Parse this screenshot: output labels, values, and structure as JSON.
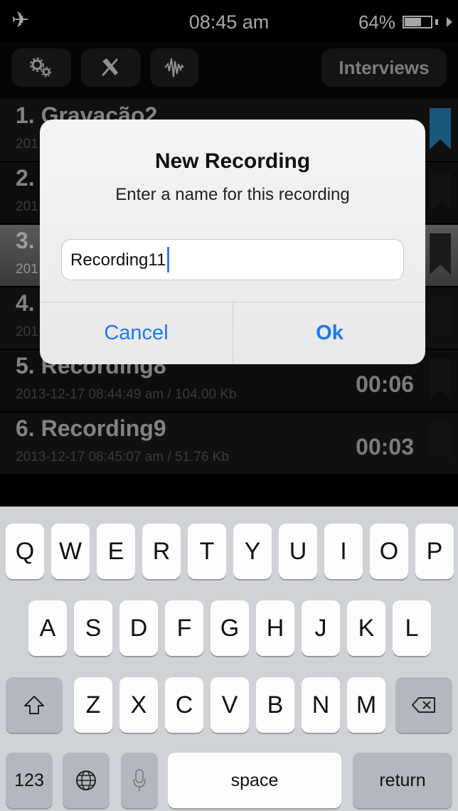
{
  "status_bar": {
    "airplane_icon": "airplane-icon",
    "time": "08:45 am",
    "battery_percent": "64%",
    "battery_level": 0.64
  },
  "toolbar": {
    "settings_icon": "gears-icon",
    "tools_icon": "tools-icon",
    "waveform_icon": "waveform-icon",
    "interviews_label": "Interviews"
  },
  "recordings": [
    {
      "title": "1. Gravação2",
      "meta": "201",
      "duration": "",
      "bookmarked": true
    },
    {
      "title": "2.",
      "meta": "201",
      "duration": "",
      "bookmarked": false
    },
    {
      "title": "3.",
      "meta": "201",
      "duration": "",
      "bookmarked": false,
      "selected": true
    },
    {
      "title": "4.",
      "meta": "201",
      "duration": "",
      "bookmarked": false
    },
    {
      "title": "5. Recording8",
      "meta": "2013-12-17 08:44:49 am / 104.00 Kb",
      "duration": "00:06",
      "bookmarked": false
    },
    {
      "title": "6. Recording9",
      "meta": "2013-12-17 08:45:07 am / 51.76 Kb",
      "duration": "00:03",
      "bookmarked": false
    }
  ],
  "alert": {
    "title": "New Recording",
    "message": "Enter a name for this recording",
    "input_value": "Recording11",
    "cancel_label": "Cancel",
    "ok_label": "Ok"
  },
  "keyboard": {
    "row1": [
      "Q",
      "W",
      "E",
      "R",
      "T",
      "Y",
      "U",
      "I",
      "O",
      "P"
    ],
    "row2": [
      "A",
      "S",
      "D",
      "F",
      "G",
      "H",
      "J",
      "K",
      "L"
    ],
    "row3": [
      "Z",
      "X",
      "C",
      "V",
      "B",
      "N",
      "M"
    ],
    "numbers_label": "123",
    "space_label": "space",
    "return_label": "return"
  },
  "colors": {
    "accent_blue": "#1a7bf2",
    "bookmark_active": "#2a84bd"
  }
}
